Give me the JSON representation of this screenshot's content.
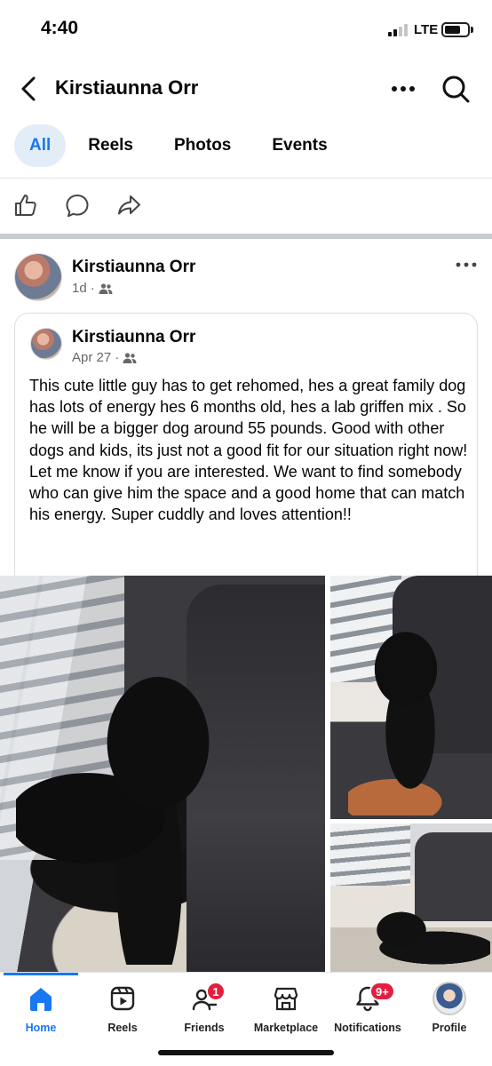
{
  "status_bar": {
    "time": "4:40",
    "network": "LTE"
  },
  "header": {
    "title": "Kirstiaunna Orr"
  },
  "tabs": [
    {
      "label": "All",
      "active": true
    },
    {
      "label": "Reels",
      "active": false
    },
    {
      "label": "Photos",
      "active": false
    },
    {
      "label": "Events",
      "active": false
    }
  ],
  "post": {
    "author": "Kirstiaunna Orr",
    "time": "1d",
    "audience_icon": "friends-icon",
    "shared": {
      "author": "Kirstiaunna Orr",
      "time": "Apr 27",
      "audience_icon": "friends-icon",
      "text": "This cute little guy has to get rehomed, hes a great family dog has lots of energy hes 6 months old, hes a lab griffen mix . So he will be a bigger dog  around 55 pounds. Good with other dogs and kids, its just not a good fit for our situation right now! Let me know if you are interested. We want to find somebody who can give him the space and a good home that can match his energy. Super cuddly and loves attention!!"
    }
  },
  "bottom_nav": {
    "items": [
      {
        "label": "Home",
        "icon": "home-icon",
        "active": true
      },
      {
        "label": "Reels",
        "icon": "reels-icon"
      },
      {
        "label": "Friends",
        "icon": "friends-icon",
        "badge": "1"
      },
      {
        "label": "Marketplace",
        "icon": "marketplace-icon"
      },
      {
        "label": "Notifications",
        "icon": "bell-icon",
        "badge": "9+"
      },
      {
        "label": "Profile",
        "icon": "profile-avatar"
      }
    ]
  },
  "colors": {
    "accent": "#1877f2",
    "badge": "#e41e3f",
    "secondary_text": "#65676b"
  }
}
